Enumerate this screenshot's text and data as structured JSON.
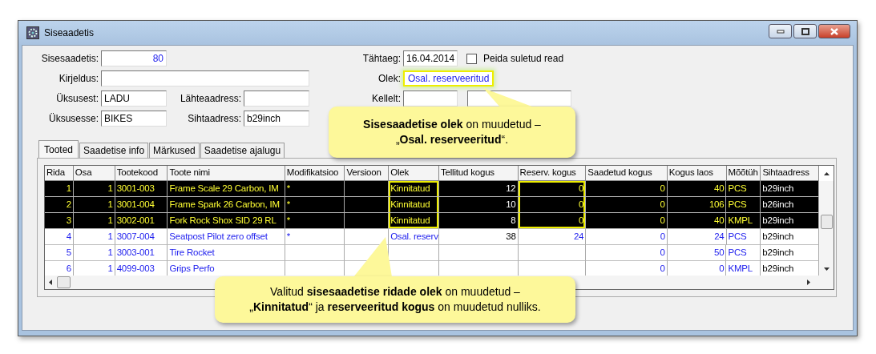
{
  "window": {
    "title": "Siseaadetis"
  },
  "form": {
    "sisesaadetis_label": "Sisesaadetis:",
    "sisesaadetis": "80",
    "kirjeldus_label": "Kirjeldus:",
    "uksusest_label": "Üksusest:",
    "uksusest": "LADU",
    "lahteaadress_label": "Lähteaadress:",
    "uksusesse_label": "Üksusesse:",
    "uksusesse": "BIKES",
    "sihtaadress_label": "Sihtaadress:",
    "sihtaadress": "b29inch",
    "tahtaeg_label": "Tähtaeg:",
    "tahtaeg": "16.04.2014",
    "hide_closed": {
      "label": "Peida suletud read",
      "checked": false
    },
    "olek_label": "Olek:",
    "olek": "Osal. reserveeritud",
    "kellelt_label": "Kellelt:"
  },
  "tabs": [
    {
      "label": "Tooted",
      "selected": true
    },
    {
      "label": "Saadetise info",
      "selected": false
    },
    {
      "label": "Märkused",
      "selected": false
    },
    {
      "label": "Saadetise ajalugu",
      "selected": false
    }
  ],
  "table": {
    "columns": [
      "Rida",
      "Osa",
      "Tootekood",
      "Toote nimi",
      "Modifikatsioo",
      "Versioon",
      "Olek",
      "Tellitud kogus",
      "Reserv. kogus",
      "Saadetud kogus",
      "Kogus laos",
      "Mõõtüh",
      "Sihtaadress"
    ],
    "rows": [
      {
        "selected": true,
        "cells": [
          "1",
          "1",
          "3001-003",
          "Frame Scale 29 Carbon, IM",
          "*",
          "",
          "Kinnitatud",
          "12",
          "0",
          "0",
          "40",
          "PCS",
          "b29inch"
        ]
      },
      {
        "selected": true,
        "cells": [
          "2",
          "1",
          "3001-004",
          "Frame Spark 26 Carbon, IM",
          "*",
          "",
          "Kinnitatud",
          "10",
          "0",
          "0",
          "106",
          "PCS",
          "b26inch"
        ]
      },
      {
        "selected": true,
        "cells": [
          "3",
          "1",
          "3002-001",
          "Fork Rock Shox SID 29 RL",
          "*",
          "",
          "Kinnitatud",
          "8",
          "0",
          "0",
          "40",
          "KMPL",
          "b29inch"
        ]
      },
      {
        "selected": false,
        "cells": [
          "4",
          "1",
          "3007-004",
          "Seatpost Pilot zero offset",
          "*",
          "",
          "Osal. reserv",
          "38",
          "24",
          "0",
          "24",
          "PCS",
          "b29inch"
        ]
      },
      {
        "selected": false,
        "cells": [
          "5",
          "1",
          "3003-001",
          "Tire Rocket",
          "",
          "",
          "",
          "",
          "",
          "0",
          "50",
          "PCS",
          "b29inch"
        ]
      },
      {
        "selected": false,
        "cells": [
          "6",
          "1",
          "4099-003",
          "Grips Perfo",
          "",
          "",
          "",
          "",
          "",
          "0",
          "0",
          "KMPL",
          "b29inch"
        ]
      }
    ]
  },
  "callouts": [
    {
      "text": "**Sisesaadetise olek** on muudetud –\n„**Osal. reserveeritud**“."
    },
    {
      "text": "Valitud **sisesaadetise ridade olek** on muudetud –\n„**Kinnitatud**“ ja **reserveeritud kogus** on muudetud nulliks."
    }
  ]
}
